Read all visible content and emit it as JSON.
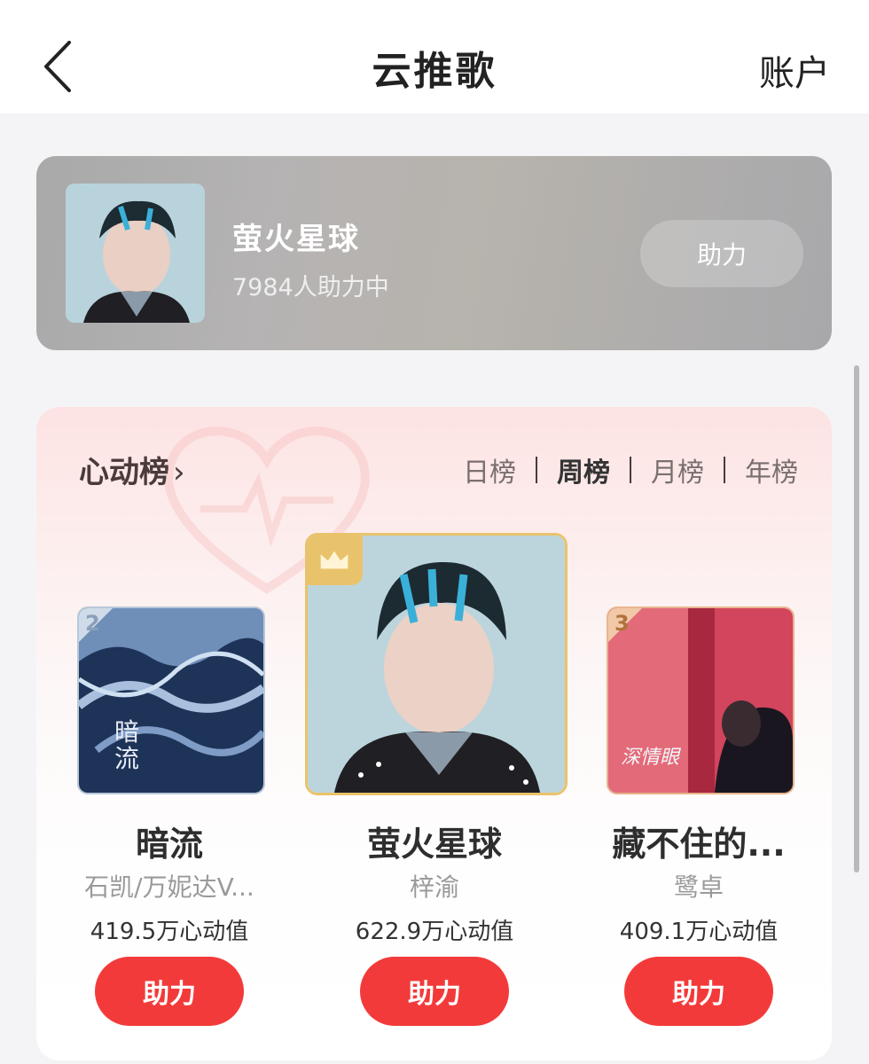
{
  "nav": {
    "title": "云推歌",
    "account_label": "账户",
    "back_icon": "chevron-left-icon"
  },
  "banner": {
    "song_title": "萤火星球",
    "supporters_text": "7984人助力中",
    "button_label": "助力"
  },
  "chart": {
    "title": "心动榜",
    "title_chevron": "›",
    "tabs": [
      {
        "label": "日榜",
        "active": false
      },
      {
        "label": "周榜",
        "active": true
      },
      {
        "label": "月榜",
        "active": false
      },
      {
        "label": "年榜",
        "active": false
      }
    ],
    "ranks": [
      {
        "rank": "2",
        "song": "暗流",
        "artist": "石凯/万妮达V...",
        "heart_value": "419.5万心动值",
        "button_label": "助力",
        "cover_text": "暗 流"
      },
      {
        "rank": "1",
        "song": "萤火星球",
        "artist": "梓渝",
        "heart_value": "622.9万心动值",
        "button_label": "助力",
        "badge_icon": "crown-icon"
      },
      {
        "rank": "3",
        "song": "藏不住的...",
        "artist": "鹭卓",
        "heart_value": "409.1万心动值",
        "button_label": "助力",
        "cover_text": "深情眼"
      }
    ]
  },
  "colors": {
    "accent_red": "#f33a3a",
    "gold_border": "#e9c36c",
    "silver_border": "#b9c8d8",
    "bronze_border": "#e8b48e"
  }
}
